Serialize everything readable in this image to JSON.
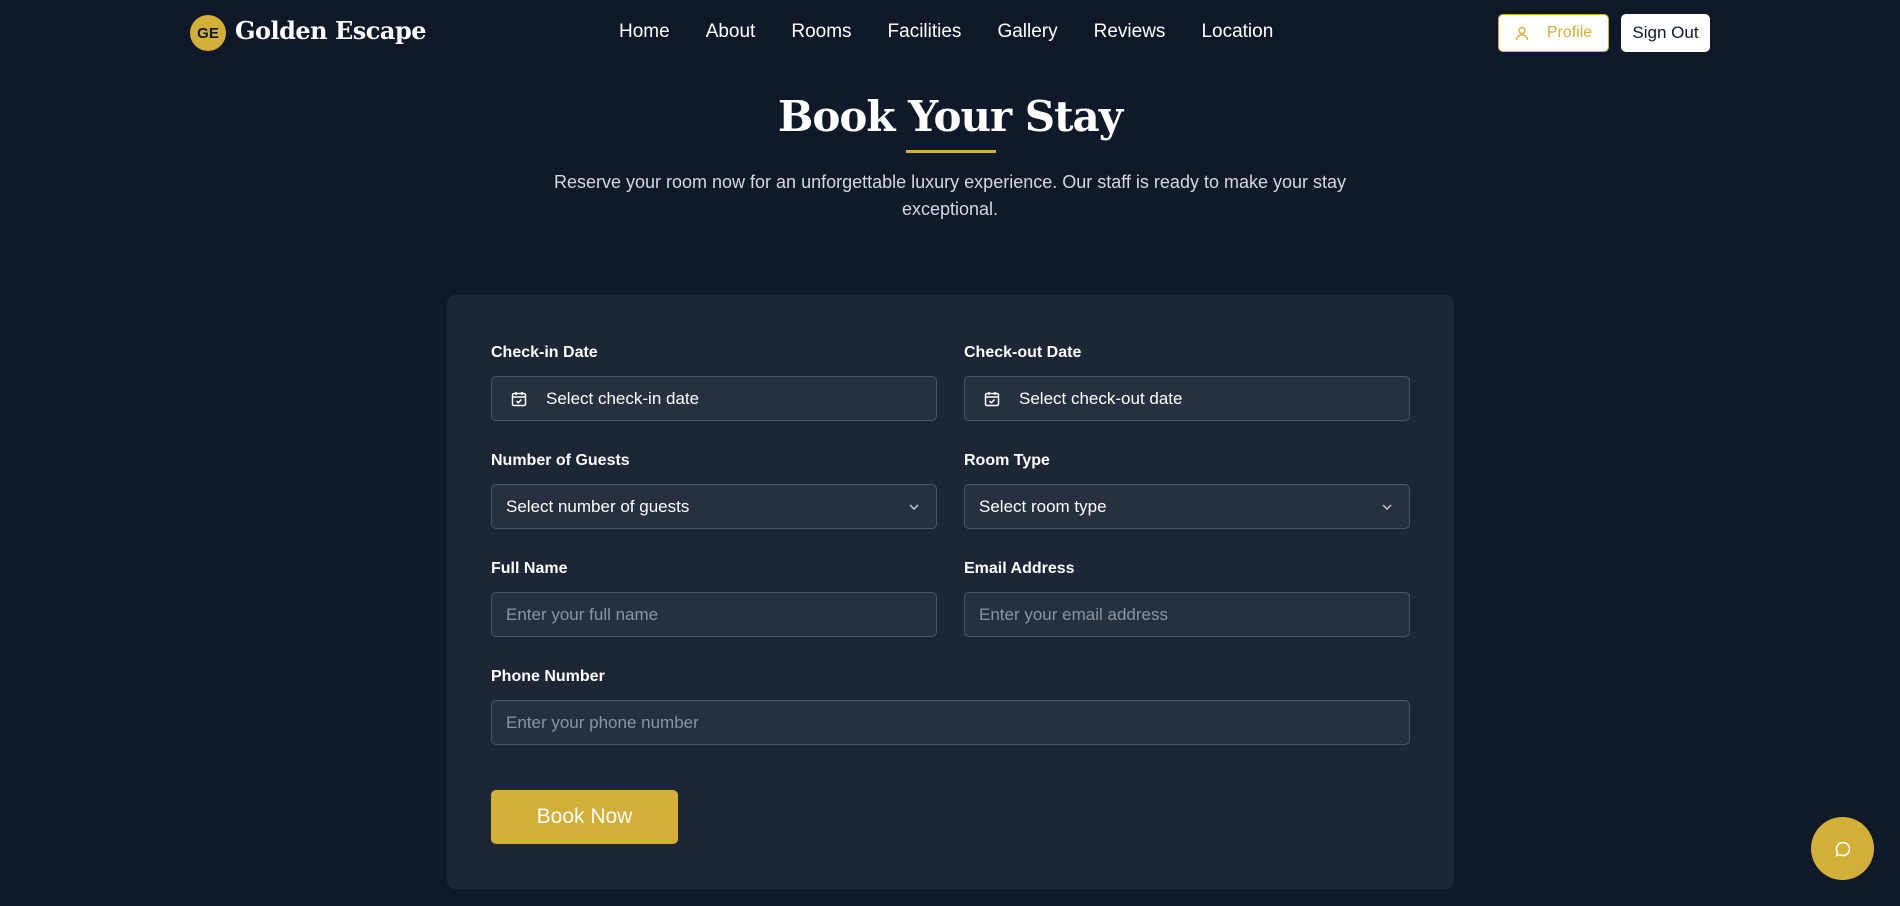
{
  "brand": {
    "badge": "GE",
    "name": "Golden Escape",
    "accent_color": "#d4af37",
    "background_color": "#0f192a"
  },
  "nav": {
    "links": [
      "Home",
      "About",
      "Rooms",
      "Facilities",
      "Gallery",
      "Reviews",
      "Location"
    ]
  },
  "header_actions": {
    "profile_label": "Profile",
    "profile_icon": "user-icon",
    "signout_label": "Sign Out"
  },
  "hero": {
    "title": "Book Your Stay",
    "subtitle": "Reserve your room now for an unforgettable luxury experience. Our staff is ready to make your stay exceptional."
  },
  "form": {
    "checkin": {
      "label": "Check-in Date",
      "value": "Select check-in date",
      "icon": "calendar-icon"
    },
    "checkout": {
      "label": "Check-out Date",
      "value": "Select check-out date",
      "icon": "calendar-icon"
    },
    "guests": {
      "label": "Number of Guests",
      "value": "Select number of guests"
    },
    "room_type": {
      "label": "Room Type",
      "value": "Select room type"
    },
    "full_name": {
      "label": "Full Name",
      "placeholder": "Enter your full name"
    },
    "email": {
      "label": "Email Address",
      "placeholder": "Enter your email address"
    },
    "phone": {
      "label": "Phone Number",
      "placeholder": "Enter your phone number"
    },
    "submit_label": "Book Now"
  },
  "chat": {
    "icon": "chat-icon"
  }
}
